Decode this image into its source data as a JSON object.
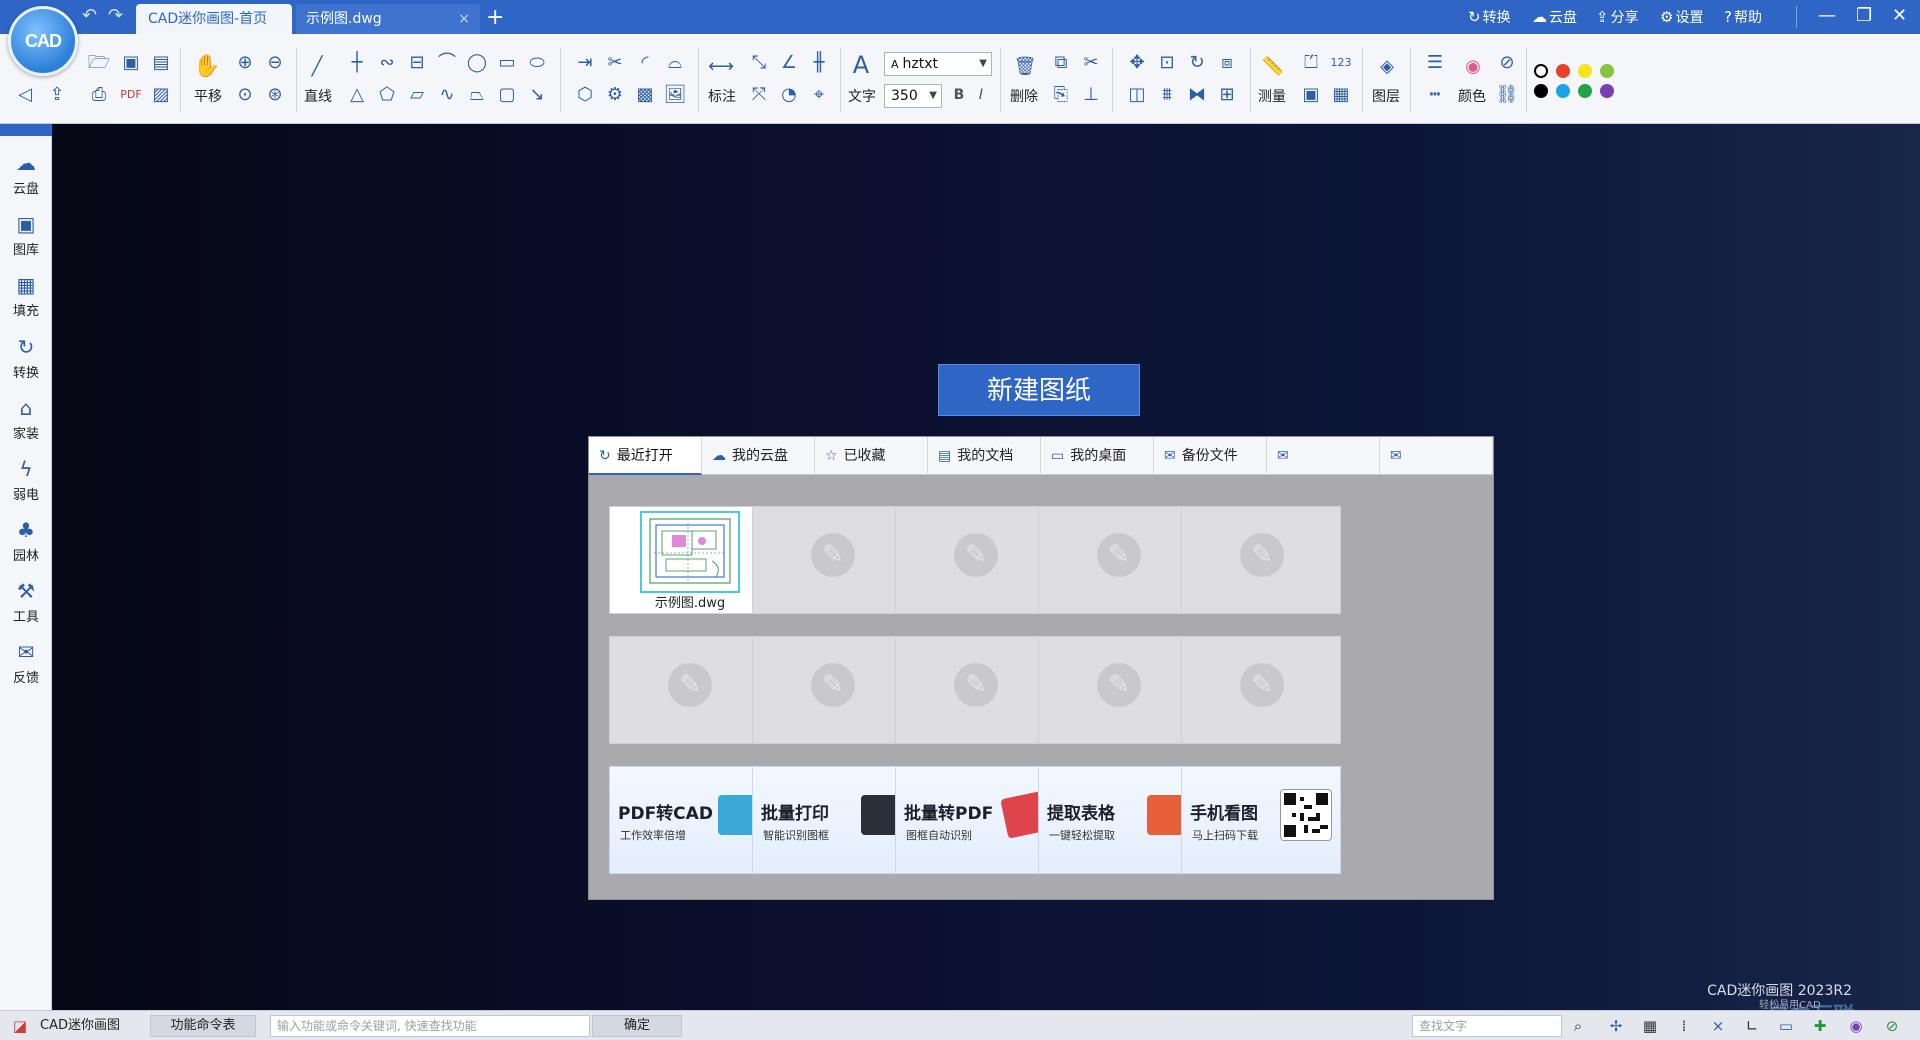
{
  "titlebar": {
    "logo_text": "CAD",
    "undo_icon": "↶",
    "redo_icon": "↷",
    "tabs": [
      {
        "label": "CAD迷你画图-首页"
      },
      {
        "label": "示例图.dwg",
        "close": "×"
      }
    ],
    "add_tab": "+",
    "actions": [
      {
        "label": "转换",
        "icon": "↻"
      },
      {
        "label": "云盘",
        "icon": "☁"
      },
      {
        "label": "分享",
        "icon": "⇪"
      },
      {
        "label": "设置",
        "icon": "⚙"
      },
      {
        "label": "帮助",
        "icon": "?"
      }
    ],
    "window": {
      "minimize": "—",
      "restore": "❐",
      "close": "✕"
    }
  },
  "ribbon": {
    "labels": {
      "pan": "平移",
      "line": "直线",
      "dimension": "标注",
      "text": "文字",
      "delete": "删除",
      "measure": "测量",
      "layer": "图层",
      "color": "颜色"
    },
    "font_select": {
      "value": "hztxt",
      "icon": "A"
    },
    "size_select": {
      "value": "350"
    },
    "bold": "B",
    "italic": "I",
    "swatches": [
      "#000000",
      "#e8402b",
      "#f4e51c",
      "#86c442",
      "#000000",
      "#1ba3e8",
      "#24a24a",
      "#7a3fb0"
    ]
  },
  "sidebar": {
    "items": [
      {
        "label": "云盘",
        "icon": "☁"
      },
      {
        "label": "图库",
        "icon": "▣"
      },
      {
        "label": "填充",
        "icon": "▦"
      },
      {
        "label": "转换",
        "icon": "↻"
      },
      {
        "label": "家装",
        "icon": "⌂"
      },
      {
        "label": "弱电",
        "icon": "ϟ"
      },
      {
        "label": "园林",
        "icon": "♣"
      },
      {
        "label": "工具",
        "icon": "⚒"
      },
      {
        "label": "反馈",
        "icon": "✉"
      }
    ]
  },
  "main": {
    "new_drawing": "新建图纸",
    "tabs": [
      {
        "label": "最近打开",
        "icon": "↻"
      },
      {
        "label": "我的云盘",
        "icon": "☁"
      },
      {
        "label": "已收藏",
        "icon": "☆"
      },
      {
        "label": "我的文档",
        "icon": "▤"
      },
      {
        "label": "我的桌面",
        "icon": "▭"
      },
      {
        "label": "备份文件",
        "icon": "✉"
      },
      {
        "label": "",
        "icon": "✉"
      },
      {
        "label": "",
        "icon": "✉"
      }
    ],
    "recent_file": {
      "name": "示例图.dwg"
    },
    "placeholder_icon": "✎",
    "promos": [
      {
        "title": "PDF转CAD",
        "subtitle": "工作效率倍增",
        "color": "#3aa8d8"
      },
      {
        "title": "批量打印",
        "subtitle": "智能识别图框",
        "color": "#2b2f3a"
      },
      {
        "title": "批量转PDF",
        "subtitle": "图框自动识别",
        "color": "#e0444b"
      },
      {
        "title": "提取表格",
        "subtitle": "一键轻松提取",
        "color": "#e8603a"
      },
      {
        "title": "手机看图",
        "subtitle": "马上扫码下载",
        "color": "#222222"
      }
    ],
    "watermark": {
      "line1": "CAD迷你画图 2023R2",
      "line2": "轻松易用CAD",
      "overlay": "自由互联"
    }
  },
  "statusbar": {
    "app_name": "CAD迷你画图",
    "command_table": "功能命令表",
    "search_placeholder": "输入功能或命令关键词, 快速查找功能",
    "confirm": "确定",
    "find_text_placeholder": "查找文字"
  }
}
